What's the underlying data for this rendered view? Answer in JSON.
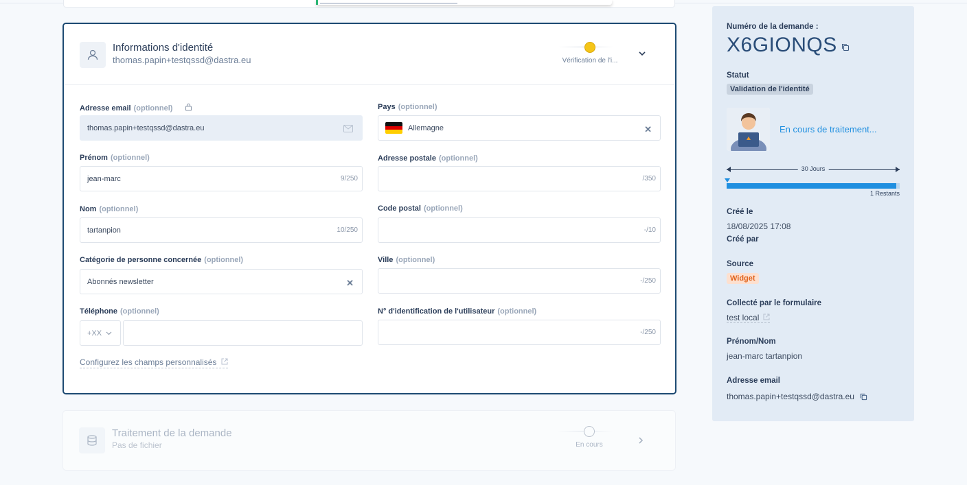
{
  "identity_card": {
    "title": "Informations d'identité",
    "email": "thomas.papin+testqssd@dastra.eu",
    "step_label": "Vérification de l'i...",
    "step_color": "#f5c518",
    "fields": {
      "email": {
        "label": "Adresse email",
        "opt": "(optionnel)",
        "value": "thomas.papin+testqssd@dastra.eu"
      },
      "country": {
        "label": "Pays",
        "opt": "(optionnel)",
        "value": "Allemagne"
      },
      "firstname": {
        "label": "Prénom",
        "opt": "(optionnel)",
        "value": "jean-marc",
        "counter": "9/250"
      },
      "address": {
        "label": "Adresse postale",
        "opt": "(optionnel)",
        "value": "",
        "counter": "/350"
      },
      "lastname": {
        "label": "Nom",
        "opt": "(optionnel)",
        "value": "tartanpion",
        "counter": "10/250"
      },
      "zipcode": {
        "label": "Code postal",
        "opt": "(optionnel)",
        "value": "",
        "counter": "-/10"
      },
      "category": {
        "label": "Catégorie de personne concernée",
        "opt": "(optionnel)",
        "value": "Abonnés newsletter"
      },
      "city": {
        "label": "Ville",
        "opt": "(optionnel)",
        "value": "",
        "counter": "-/250"
      },
      "phone": {
        "label": "Téléphone",
        "opt": "(optionnel)",
        "prefix": "+XX",
        "value": ""
      },
      "user_id": {
        "label": "N° d'identification de l'utilisateur",
        "opt": "(optionnel)",
        "value": "",
        "counter": "-/250"
      }
    },
    "config_link": "Configurez les champs personnalisés"
  },
  "processing_card": {
    "title": "Traitement de la demande",
    "subtitle": "Pas de fichier",
    "step_label": "En cours"
  },
  "sidebar": {
    "request_number_label": "Numéro de la demande :",
    "request_number": "X6GIONQS",
    "status_label": "Statut",
    "status_value": "Validation de l'identité",
    "processing_text": "En cours de traitement...",
    "timeline_label": "30 Jours",
    "remaining": "1 Restants",
    "progress_fraction": 0.98,
    "created_label": "Créé le",
    "created_value": "18/08/2025 17:08",
    "created_by_label": "Créé par",
    "source_label": "Source",
    "source_value": "Widget",
    "form_label": "Collecté par le formulaire",
    "form_value": "test local",
    "name_label": "Prénom/Nom",
    "name_value": "jean-marc tartanpion",
    "email_label": "Adresse email",
    "email_value": "thomas.papin+testqssd@dastra.eu"
  },
  "colors": {
    "card_border": "#1d4a72",
    "accent_blue": "#1f8fe0",
    "badge_orange_bg": "#fde0cf",
    "badge_orange_fg": "#e0651f"
  }
}
